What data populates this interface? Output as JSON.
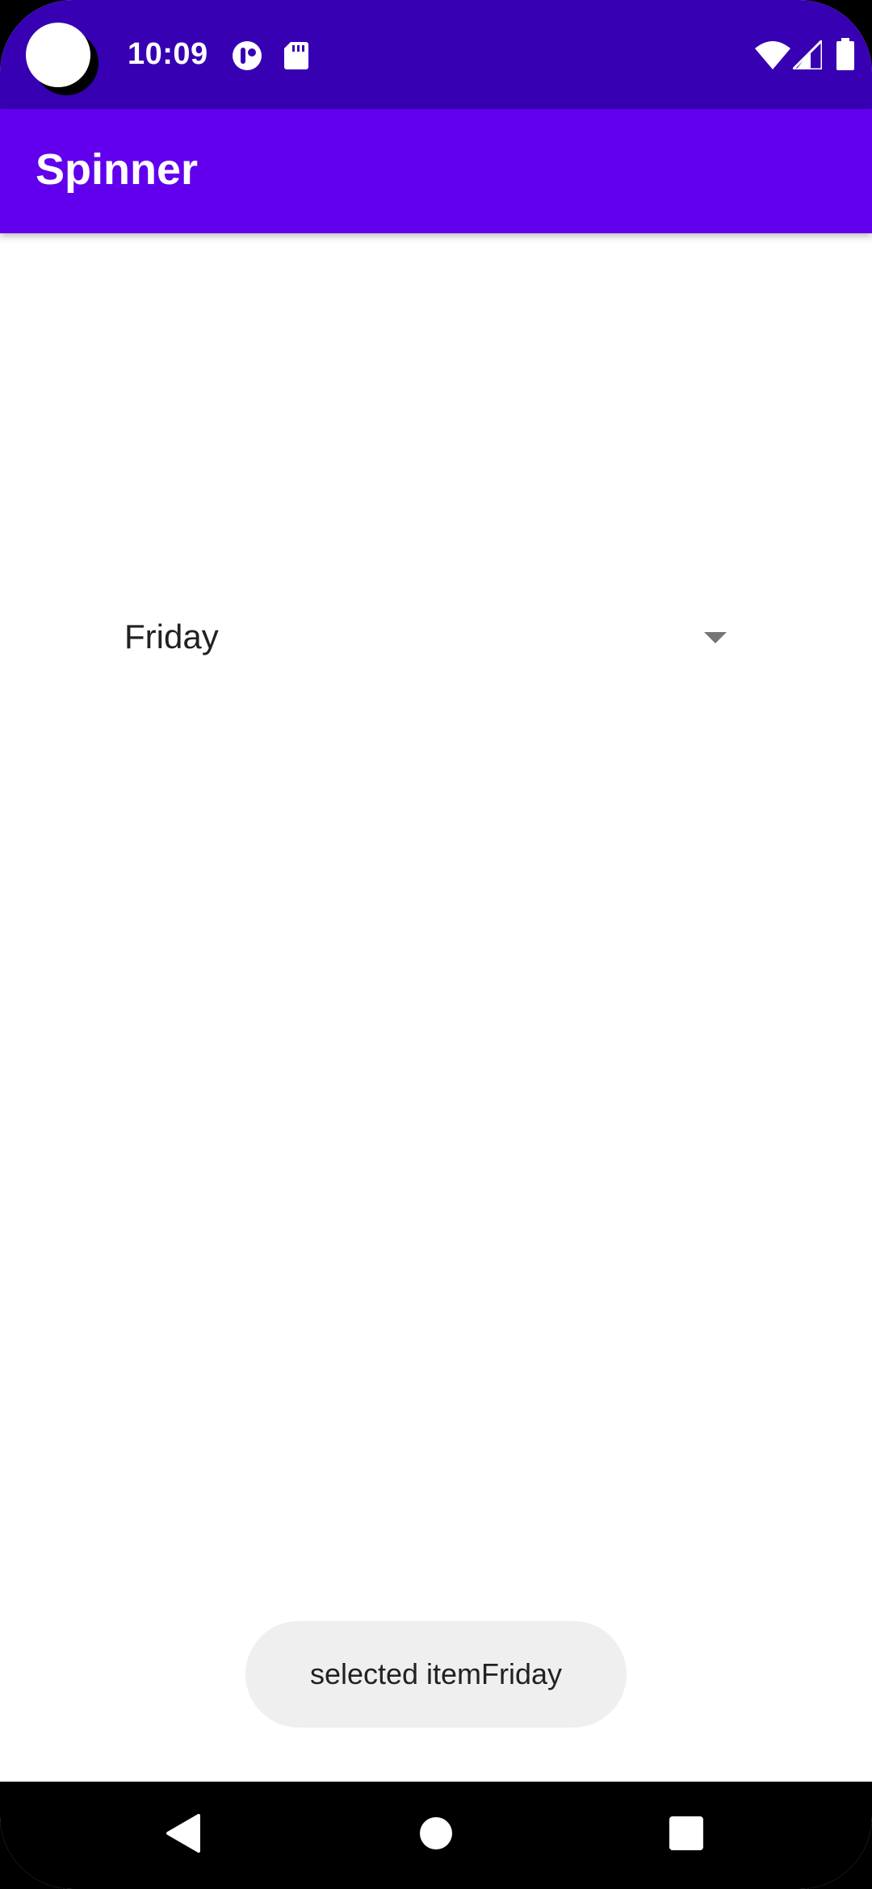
{
  "status_bar": {
    "time": "10:09",
    "icons": [
      "camera-cutout-icon",
      "app-notification-icon",
      "sd-card-icon",
      "wifi-icon",
      "cell-signal-icon",
      "battery-icon"
    ],
    "background": "#3700b3"
  },
  "app_bar": {
    "title": "Spinner",
    "background": "#6200ee"
  },
  "spinner": {
    "selected_value": "Friday",
    "icon": "dropdown-arrow-icon"
  },
  "toast": {
    "message": "selected itemFriday"
  },
  "nav_bar": {
    "buttons": [
      "back-icon",
      "home-icon",
      "recents-icon"
    ]
  }
}
